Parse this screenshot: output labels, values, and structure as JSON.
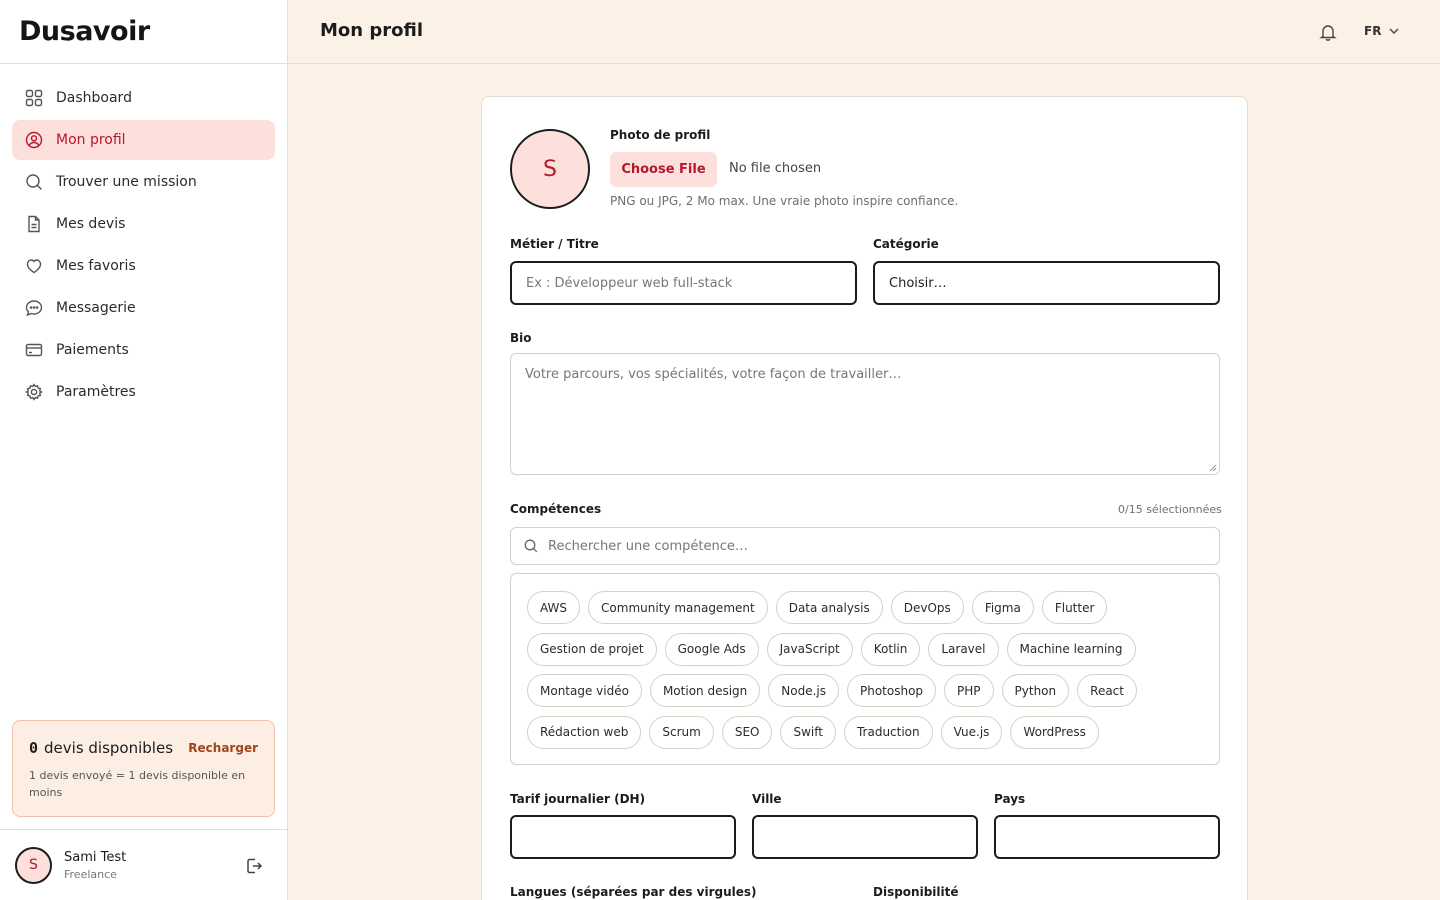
{
  "app": {
    "logo_text": "Dusavoir"
  },
  "sidebar": {
    "items": [
      {
        "label": "Dashboard",
        "icon": "grid-icon"
      },
      {
        "label": "Mon profil",
        "icon": "user-circle-icon"
      },
      {
        "label": "Trouver une mission",
        "icon": "search-icon"
      },
      {
        "label": "Mes devis",
        "icon": "document-icon"
      },
      {
        "label": "Mes favoris",
        "icon": "heart-icon"
      },
      {
        "label": "Messagerie",
        "icon": "chat-icon"
      },
      {
        "label": "Paiements",
        "icon": "credit-card-icon"
      },
      {
        "label": "Paramètres",
        "icon": "gear-icon"
      }
    ],
    "active_item": "Mon profil",
    "quota": {
      "count": "0",
      "label": "devis disponibles",
      "reload_label": "Recharger",
      "note": "1 devis envoyé = 1 devis disponible en moins"
    },
    "user": {
      "initial": "S",
      "name": "Sami Test",
      "role": "Freelance"
    }
  },
  "header": {
    "title": "Mon profil",
    "language": "FR"
  },
  "form": {
    "photo": {
      "initial": "S",
      "label": "Photo de profil",
      "button_label": "Choose File",
      "status": "No file chosen",
      "hint": "PNG ou JPG, 2 Mo max. Une vraie photo inspire confiance."
    },
    "job_title": {
      "label": "Métier / Titre",
      "placeholder": "Ex : Développeur web full-stack",
      "value": ""
    },
    "category": {
      "label": "Catégorie",
      "value": "Choisir…"
    },
    "bio": {
      "label": "Bio",
      "placeholder": "Votre parcours, vos spécialités, votre façon de travailler…",
      "value": ""
    },
    "skills": {
      "label": "Compétences",
      "selected_count": "0/15 sélectionnées",
      "search_placeholder": "Rechercher une compétence…",
      "rows": [
        [
          "AWS",
          "Community management",
          "Data analysis",
          "DevOps",
          "Figma",
          "Flutter"
        ],
        [
          "Gestion de projet",
          "Google Ads",
          "JavaScript",
          "Kotlin",
          "Laravel",
          "Machine learning"
        ],
        [
          "Montage vidéo",
          "Motion design",
          "Node.js",
          "Photoshop",
          "PHP",
          "Python",
          "React"
        ],
        [
          "Rédaction web",
          "Scrum",
          "SEO",
          "Swift",
          "Traduction",
          "Vue.js",
          "WordPress"
        ]
      ]
    },
    "daily_rate": {
      "label": "Tarif journalier (DH)",
      "value": ""
    },
    "city": {
      "label": "Ville",
      "value": ""
    },
    "country": {
      "label": "Pays",
      "value": ""
    },
    "languages": {
      "label": "Langues (séparées par des virgules)"
    },
    "availability": {
      "label": "Disponibilité"
    }
  },
  "colors": {
    "accent": "#b4182d",
    "accent_soft": "#fde0dc",
    "page_bg": "#fbf1e6"
  }
}
